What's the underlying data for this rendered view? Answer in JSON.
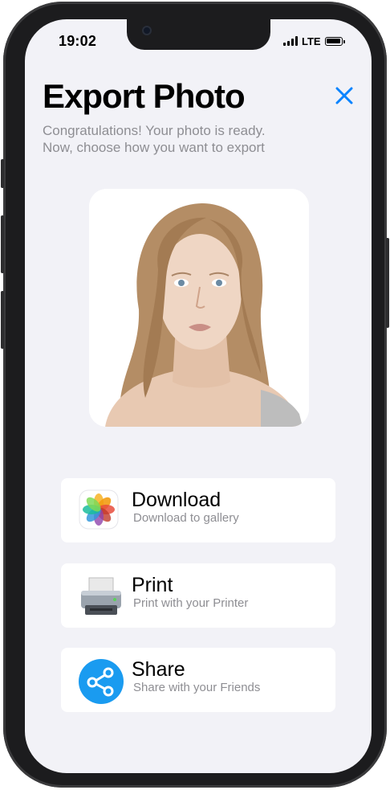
{
  "status_bar": {
    "time": "19:02",
    "network": "LTE"
  },
  "header": {
    "title": "Export Photo",
    "subtitle_line1": "Congratulations! Your photo is ready.",
    "subtitle_line2": "Now, choose how you want to export"
  },
  "colors": {
    "accent": "#0a84ff",
    "background": "#f2f2f7",
    "secondary_text": "#8e8e93"
  },
  "photo": {
    "icon": "portrait-photo"
  },
  "actions": [
    {
      "title": "Download",
      "subtitle": "Download to gallery",
      "icon": "photos-app-icon"
    },
    {
      "title": "Print",
      "subtitle": "Print with your Printer",
      "icon": "printer-icon"
    },
    {
      "title": "Share",
      "subtitle": "Share with your Friends",
      "icon": "share-icon"
    }
  ]
}
